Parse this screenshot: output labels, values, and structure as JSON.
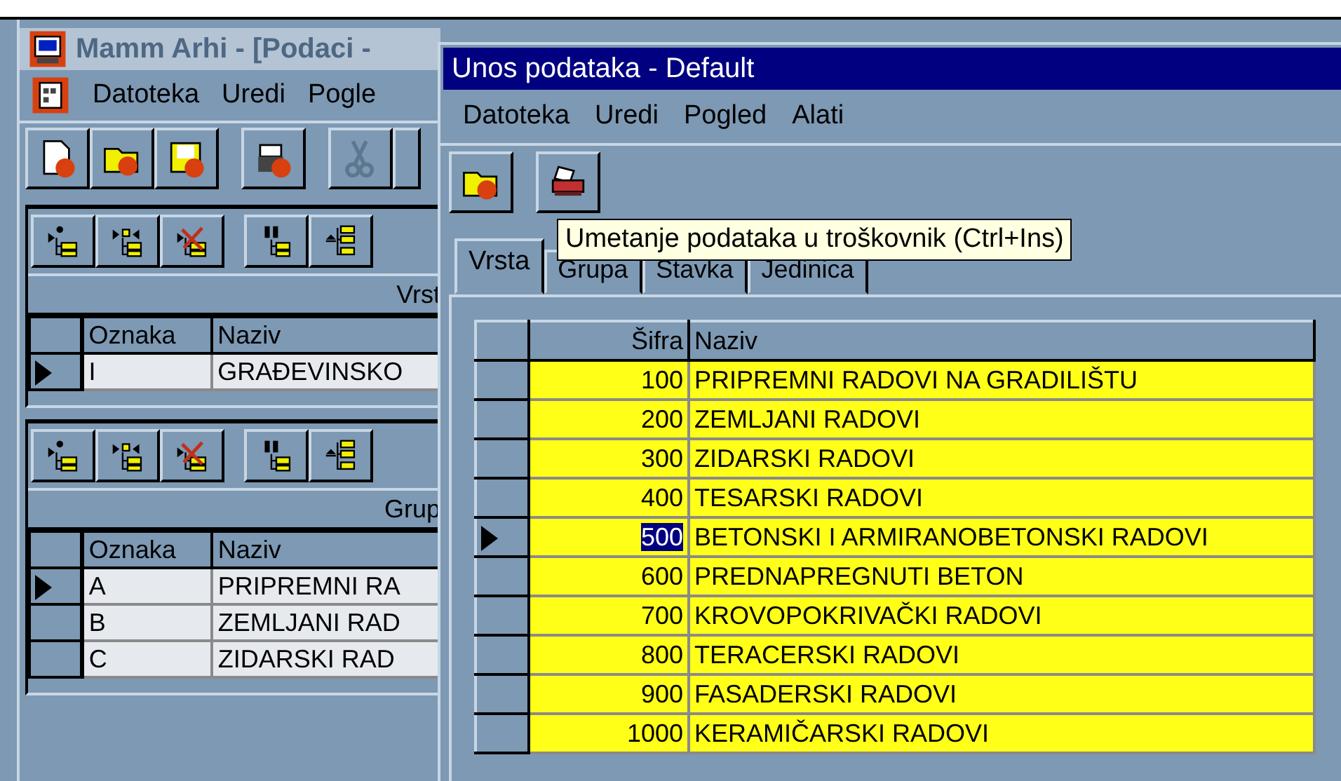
{
  "back_window": {
    "title": "Mamm Arhi - [Podaci -",
    "menu": [
      "Datoteka",
      "Uredi",
      "Pogle"
    ],
    "panels": [
      {
        "caption": "Vrst",
        "columns": [
          "Oznaka",
          "Naziv"
        ],
        "rows": [
          {
            "cells": [
              "I",
              "GRAĐEVINSKO"
            ],
            "current": true
          }
        ]
      },
      {
        "caption": "Grup",
        "columns": [
          "Oznaka",
          "Naziv"
        ],
        "rows": [
          {
            "cells": [
              "A",
              "PRIPREMNI RA"
            ],
            "current": true
          },
          {
            "cells": [
              "B",
              "ZEMLJANI RAD"
            ],
            "current": false
          },
          {
            "cells": [
              "C",
              "ZIDARSKI RAD"
            ],
            "current": false
          }
        ]
      }
    ]
  },
  "front_window": {
    "title": "Unos podataka - Default",
    "menu": [
      "Datoteka",
      "Uredi",
      "Pogled",
      "Alati"
    ],
    "tooltip": "Umetanje podataka u troškovnik (Ctrl+Ins)",
    "tabs": [
      {
        "label": "Vrsta",
        "selected": true
      },
      {
        "label": "Grupa",
        "selected": false
      },
      {
        "label": "Stavka",
        "selected": false
      },
      {
        "label": "Jedinica",
        "selected": false
      }
    ],
    "grid": {
      "columns": [
        "Šifra",
        "Naziv"
      ],
      "rows": [
        {
          "cells": [
            "100",
            "PRIPREMNI RADOVI NA GRADILIŠTU"
          ],
          "current": false
        },
        {
          "cells": [
            "200",
            "ZEMLJANI RADOVI"
          ],
          "current": false
        },
        {
          "cells": [
            "300",
            "ZIDARSKI RADOVI"
          ],
          "current": false
        },
        {
          "cells": [
            "400",
            "TESARSKI RADOVI"
          ],
          "current": false
        },
        {
          "cells": [
            "500",
            "BETONSKI I ARMIRANOBETONSKI RADOVI"
          ],
          "current": true
        },
        {
          "cells": [
            "600",
            "PREDNAPREGNUTI BETON"
          ],
          "current": false
        },
        {
          "cells": [
            "700",
            "KROVOPOKRIVAČKI RADOVI"
          ],
          "current": false
        },
        {
          "cells": [
            "800",
            "TERACERSKI RADOVI"
          ],
          "current": false
        },
        {
          "cells": [
            "900",
            "FASADERSKI RADOVI"
          ],
          "current": false
        },
        {
          "cells": [
            "1000",
            "KERAMIČARSKI RADOVI"
          ],
          "current": false
        }
      ]
    }
  }
}
